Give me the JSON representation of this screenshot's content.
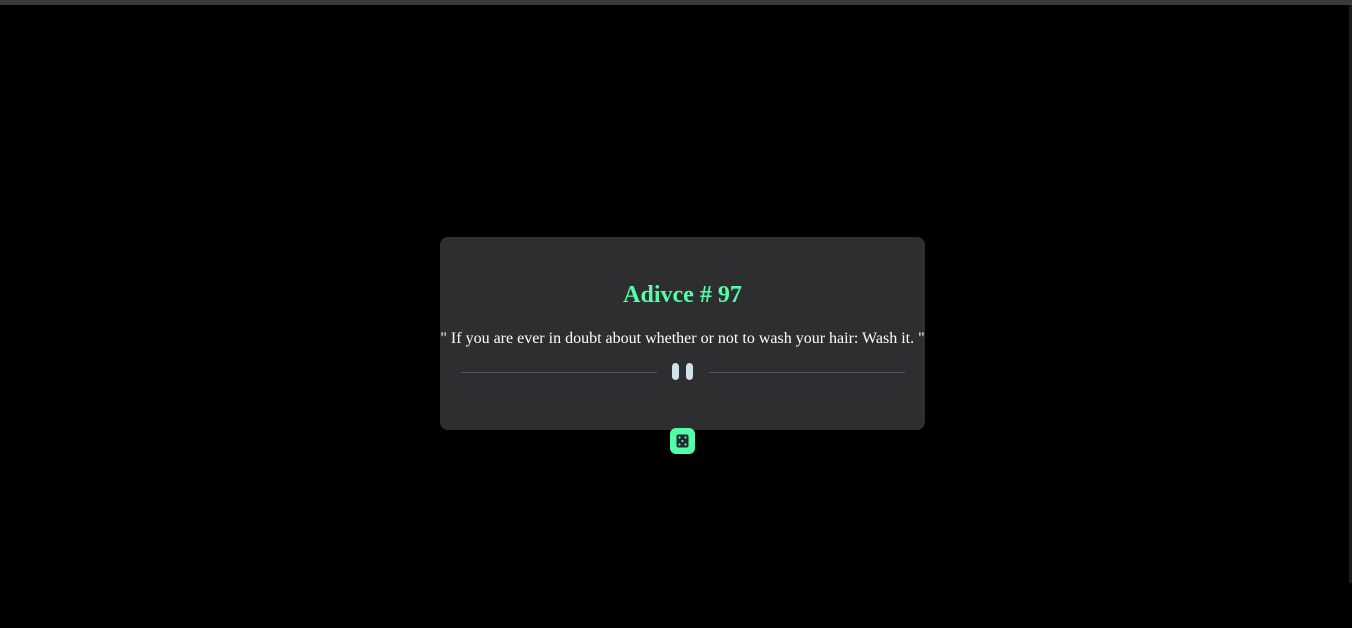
{
  "advice": {
    "title": "Adivce # 97",
    "quote": "\" If you are ever in doubt about whether or not to wash your hair: Wash it. \""
  },
  "icons": {
    "divider": "pause-icon",
    "button": "dice-icon"
  },
  "colors": {
    "background": "#000000",
    "card": "#2e2e30",
    "accent": "#52ffa8",
    "text": "#ffffff",
    "divider": "#4f5562",
    "pause": "#cee3e9"
  }
}
